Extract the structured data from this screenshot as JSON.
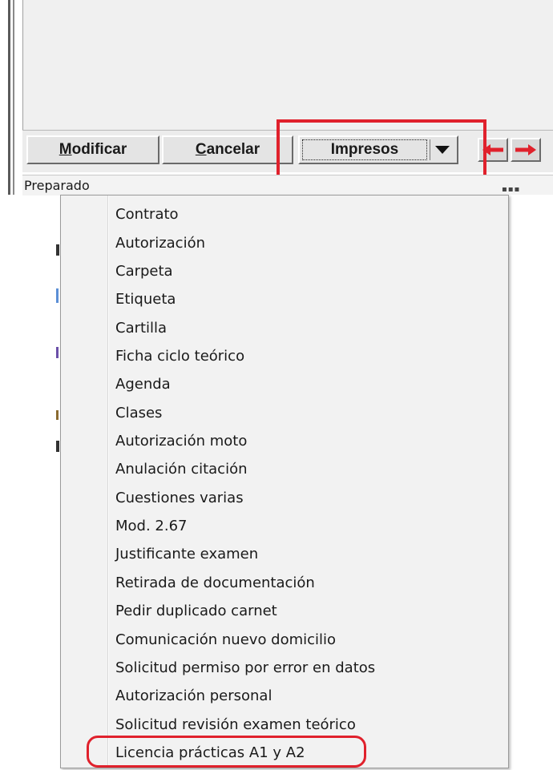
{
  "toolbar": {
    "modificar": {
      "accel": "M",
      "rest": "odificar"
    },
    "cancelar": {
      "accel": "C",
      "rest": "ancelar"
    },
    "impresos_label": "Impresos"
  },
  "status": {
    "text": "Preparado"
  },
  "colors": {
    "highlight": "#e0212c",
    "arrow": "#e0212c"
  },
  "icons": {
    "dropdown": "triangle-down",
    "prev": "arrow-left",
    "next": "arrow-right"
  },
  "menu": {
    "items": [
      "Contrato",
      "Autorización",
      "Carpeta",
      "Etiqueta",
      "Cartilla",
      "Ficha ciclo teórico",
      "Agenda",
      "Clases",
      "Autorización moto",
      "Anulación citación",
      "Cuestiones varias",
      "Mod. 2.67",
      "Justificante examen",
      "Retirada de documentación",
      "Pedir duplicado carnet",
      "Comunicación nuevo domicilio",
      "Solicitud permiso por error en datos",
      "Autorización personal",
      "Solicitud revisión examen teórico",
      "Licencia prácticas A1 y A2"
    ]
  }
}
